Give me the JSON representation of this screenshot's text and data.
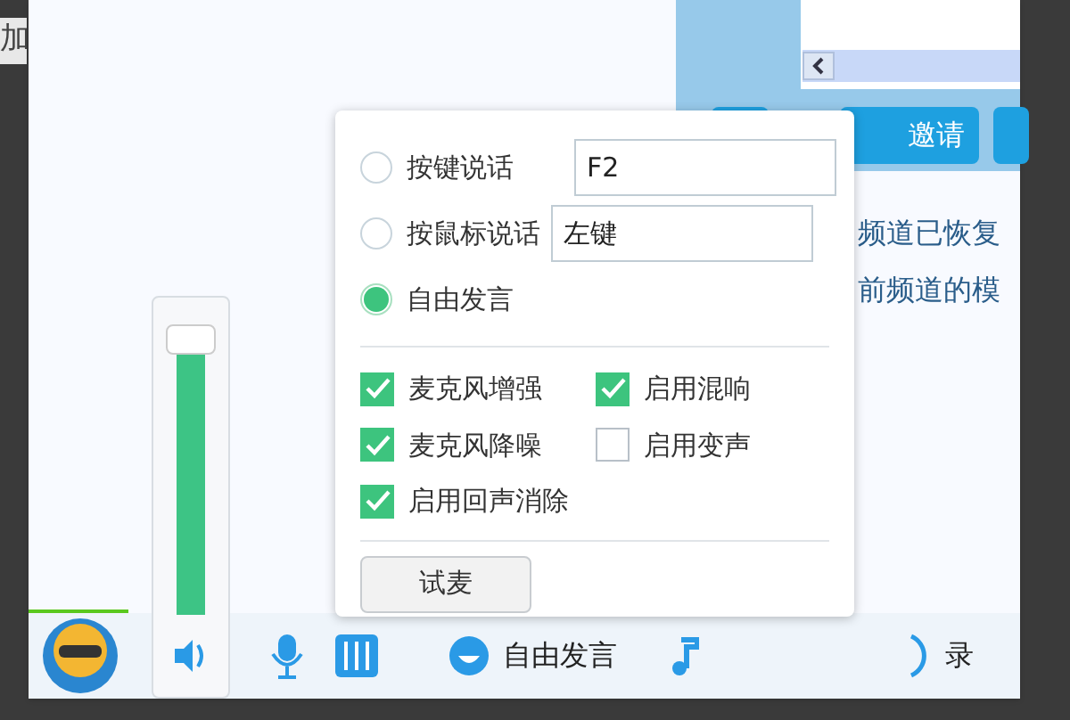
{
  "edge_text": "加",
  "channel_panel": {
    "invite_button": "邀请",
    "messages": [
      "频道已恢复",
      "前频道的模"
    ]
  },
  "voice_popup": {
    "modes": [
      {
        "label": "按键说话",
        "selected": false,
        "value": "F2"
      },
      {
        "label": "按鼠标说话",
        "selected": false,
        "value": "左键"
      },
      {
        "label": "自由发言",
        "selected": true
      }
    ],
    "options": [
      {
        "label": "麦克风增强",
        "checked": true
      },
      {
        "label": "启用混响",
        "checked": true
      },
      {
        "label": "麦克风降噪",
        "checked": true
      },
      {
        "label": "启用变声",
        "checked": false
      },
      {
        "label": "启用回声消除",
        "checked": true
      }
    ],
    "test_button": "试麦"
  },
  "volume": {
    "level": 0.96
  },
  "toolbar": {
    "mode_label": "自由发言",
    "record_label": "录"
  }
}
